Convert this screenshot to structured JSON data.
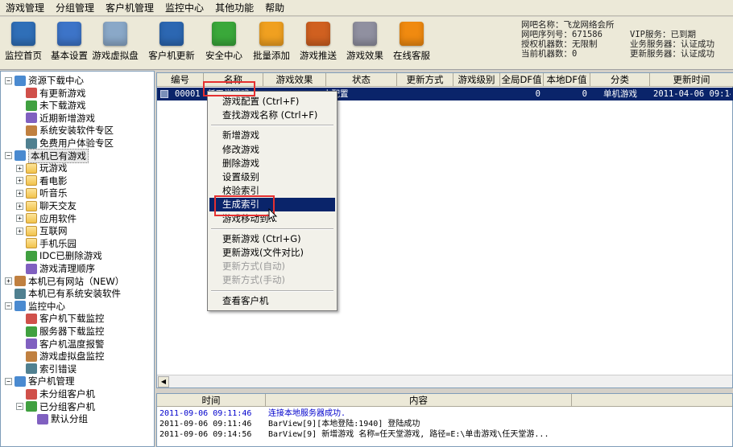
{
  "menu": [
    "游戏管理",
    "分组管理",
    "客户机管理",
    "监控中心",
    "其他功能",
    "帮助"
  ],
  "toolbar": [
    {
      "label": "监控首页",
      "icon": "monitor-icon",
      "color": "#2f6fb8"
    },
    {
      "label": "基本设置",
      "icon": "gear-icon",
      "color": "#3d74c8"
    },
    {
      "label": "游戏虚拟盘",
      "icon": "disk-icon",
      "color": "#8aa8c8"
    },
    {
      "label": "客户机更新",
      "icon": "update-icon",
      "color": "#2c67b2"
    },
    {
      "label": "安全中心",
      "icon": "shield-icon",
      "color": "#3aa83a"
    },
    {
      "label": "批量添加",
      "icon": "batch-add-icon",
      "color": "#f0a020"
    },
    {
      "label": "游戏推送",
      "icon": "push-icon",
      "color": "#d06020"
    },
    {
      "label": "游戏效果",
      "icon": "gamepad-icon",
      "color": "#9090a0"
    },
    {
      "label": "在线客服",
      "icon": "chat-icon",
      "color": "#f08a10"
    }
  ],
  "info": {
    "bar_name": "网吧名称：飞龙网络会所",
    "bar_serial": "网吧序列号：671586",
    "licensed": "授权机器数：无限制",
    "current": "当前机器数：0",
    "vip": "VIP服务：已到期",
    "biz_server": "业务服务器：认证成功",
    "update_server": "更新服务器：认证成功"
  },
  "tree": [
    {
      "level": 0,
      "expander": "-",
      "icon": "resource-icon",
      "label": "资源下载中心"
    },
    {
      "level": 1,
      "icon": "update-game-icon",
      "label": "有更新游戏"
    },
    {
      "level": 1,
      "icon": "download-icon",
      "label": "未下载游戏"
    },
    {
      "level": 1,
      "icon": "new-game-icon",
      "label": "近期新增游戏"
    },
    {
      "level": 1,
      "icon": "install-icon",
      "label": "系统安装软件专区"
    },
    {
      "level": 1,
      "icon": "free-icon",
      "label": "免费用户体验专区"
    },
    {
      "level": 0,
      "expander": "-",
      "icon": "local-games-icon",
      "label": "本机已有游戏",
      "selected": true
    },
    {
      "level": 1,
      "expander": "+",
      "icon": "folder-icon",
      "label": "玩游戏"
    },
    {
      "level": 1,
      "expander": "+",
      "icon": "folder-icon",
      "label": "看电影"
    },
    {
      "level": 1,
      "expander": "+",
      "icon": "folder-icon",
      "label": "听音乐"
    },
    {
      "level": 1,
      "expander": "+",
      "icon": "folder-icon",
      "label": "聊天交友"
    },
    {
      "level": 1,
      "expander": "+",
      "icon": "folder-icon",
      "label": "应用软件"
    },
    {
      "level": 1,
      "expander": "+",
      "icon": "folder-icon",
      "label": "互联网"
    },
    {
      "level": 1,
      "icon": "folder-icon",
      "label": "手机乐园"
    },
    {
      "level": 1,
      "icon": "idc-icon",
      "label": "IDC已删除游戏"
    },
    {
      "level": 1,
      "icon": "broom-icon",
      "label": "游戏清理顺序"
    },
    {
      "level": 0,
      "expander": "+",
      "icon": "website-icon",
      "label": "本机已有网站（NEW）"
    },
    {
      "level": 0,
      "icon": "software-icon",
      "label": "本机已有系统安装软件"
    },
    {
      "level": 0,
      "expander": "-",
      "icon": "monitor-center-icon",
      "label": "监控中心"
    },
    {
      "level": 1,
      "icon": "client-download-icon",
      "label": "客户机下载监控"
    },
    {
      "level": 1,
      "icon": "server-download-icon",
      "label": "服务器下载监控"
    },
    {
      "level": 1,
      "icon": "temperature-icon",
      "label": "客户机温度报警"
    },
    {
      "level": 1,
      "icon": "vdisk-monitor-icon",
      "label": "游戏虚拟盘监控"
    },
    {
      "level": 1,
      "icon": "index-error-icon",
      "label": "索引错误"
    },
    {
      "level": 0,
      "expander": "-",
      "icon": "client-manage-icon",
      "label": "客户机管理"
    },
    {
      "level": 1,
      "icon": "ungrouped-icon",
      "label": "未分组客户机"
    },
    {
      "level": 1,
      "expander": "-",
      "icon": "grouped-icon",
      "label": "已分组客户机"
    },
    {
      "level": 2,
      "icon": "default-group-icon",
      "label": "默认分组"
    }
  ],
  "grid": {
    "columns": [
      "编号",
      "名称",
      "游戏效果",
      "状态",
      "更新方式",
      "游戏级别",
      "全局DF值",
      "本地DF值",
      "分类",
      "更新时间"
    ],
    "row": [
      "00001",
      "任天堂游戏",
      "",
      "未配置",
      "",
      "",
      "0",
      "0",
      "单机游戏",
      "2011-04-06 09:14"
    ]
  },
  "context_menu": [
    {
      "label": "游戏配置 (Ctrl+F)"
    },
    {
      "label": "查找游戏名称 (Ctrl+F)"
    },
    {
      "sep": true
    },
    {
      "label": "新增游戏"
    },
    {
      "label": "修改游戏"
    },
    {
      "label": "删除游戏"
    },
    {
      "label": "设置级别"
    },
    {
      "label": "校验索引"
    },
    {
      "label": "生成索引",
      "highlight": true
    },
    {
      "label": "游戏移动到..."
    },
    {
      "sep": true
    },
    {
      "label": "更新游戏 (Ctrl+G)"
    },
    {
      "label": "更新游戏(文件对比)"
    },
    {
      "label": "更新方式(自动)",
      "disabled": true
    },
    {
      "label": "更新方式(手动)",
      "disabled": true
    },
    {
      "sep": true
    },
    {
      "label": "查看客户机"
    }
  ],
  "log": {
    "columns": [
      "时间",
      "内容"
    ],
    "rows": [
      {
        "time": "2011-09-06 09:11:46",
        "text": "连接本地服务器成功.",
        "color": "#0000cc"
      },
      {
        "time": "2011-09-06 09:11:46",
        "text": "BarView[9][本地登陆:1940] 登陆成功",
        "color": "#000000"
      },
      {
        "time": "2011-09-06 09:14:56",
        "text": "BarView[9] 新增游戏 名称=任天堂游戏, 路径=E:\\单击游戏\\任天堂游...",
        "color": "#000000"
      }
    ]
  }
}
